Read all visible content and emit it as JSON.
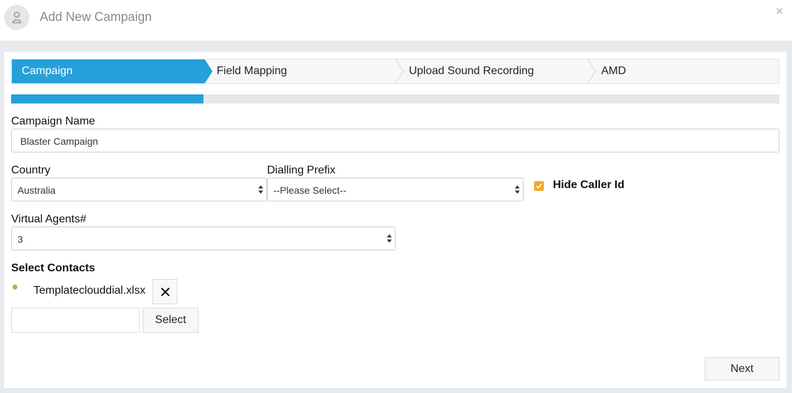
{
  "header": {
    "title": "Add New Campaign",
    "avatar_icon": "user-icon",
    "close_icon": "close-icon",
    "close_glyph": "×"
  },
  "wizard": {
    "steps": [
      {
        "label": "Campaign",
        "active": true
      },
      {
        "label": "Field Mapping",
        "active": false
      },
      {
        "label": "Upload Sound Recording",
        "active": false
      },
      {
        "label": "AMD",
        "active": false
      }
    ],
    "progress_fraction": 0.25,
    "accent_color": "#25a0da"
  },
  "form": {
    "campaign_name": {
      "label": "Campaign Name",
      "value": "Blaster Campaign"
    },
    "country": {
      "label": "Country",
      "value": "Australia"
    },
    "dialling_prefix": {
      "label": "Dialling Prefix",
      "value": "--Please Select--"
    },
    "hide_caller_id": {
      "label": "Hide Caller Id",
      "checked": true,
      "color": "#f0a92c"
    },
    "virtual_agents": {
      "label": "Virtual Agents#",
      "value": "3"
    }
  },
  "contacts": {
    "title": "Select Contacts",
    "file_name": "Templateclouddial.xlsx",
    "status_color": "#8cc63f",
    "remove_icon": "close-icon",
    "file_input_value": "",
    "select_button": "Select"
  },
  "footer": {
    "next_button": "Next"
  }
}
